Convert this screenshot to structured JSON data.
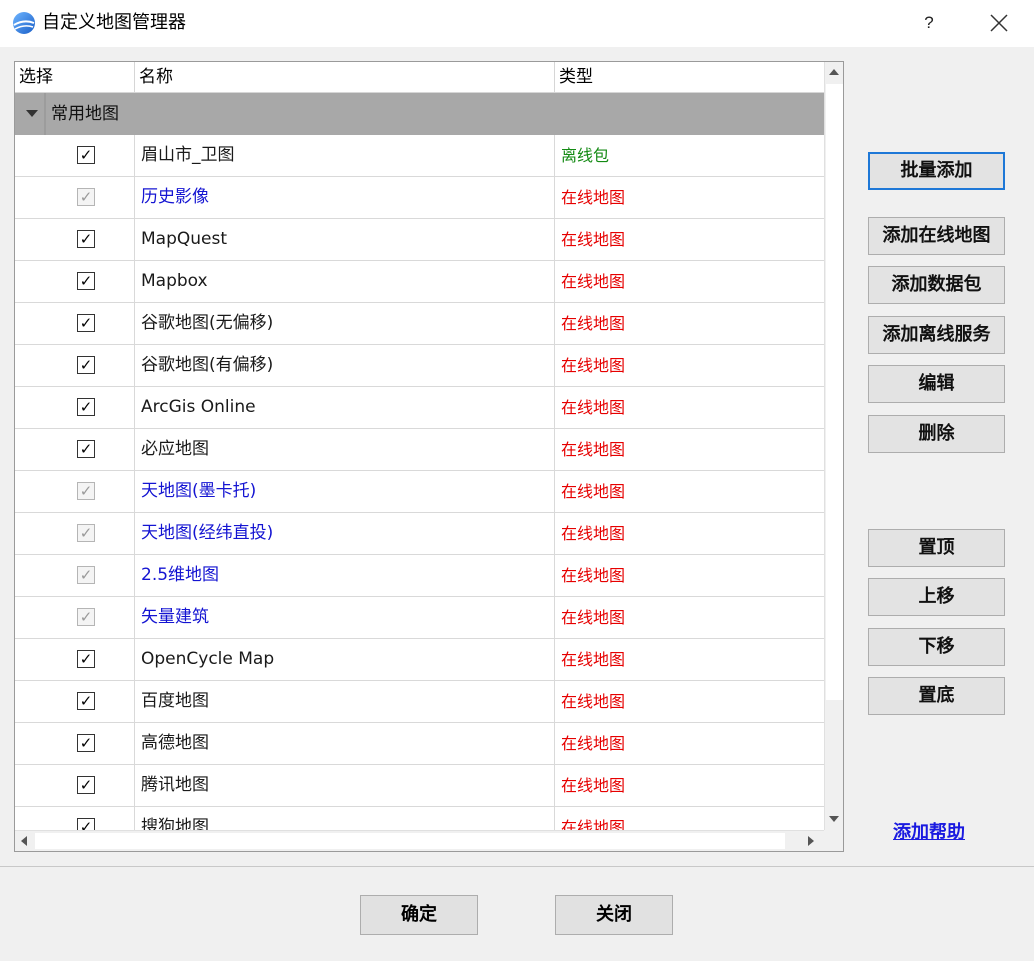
{
  "window": {
    "title": "自定义地图管理器",
    "help_label": "?"
  },
  "table": {
    "columns": [
      "选择",
      "名称",
      "类型"
    ],
    "group": {
      "label": "常用地图"
    },
    "rows": [
      {
        "name": "眉山市_卫图",
        "type": "离线包",
        "checked": true,
        "enabled": true,
        "name_color": "black",
        "type_color": "green"
      },
      {
        "name": "历史影像",
        "type": "在线地图",
        "checked": true,
        "enabled": false,
        "name_color": "blue",
        "type_color": "red"
      },
      {
        "name": "MapQuest",
        "type": "在线地图",
        "checked": true,
        "enabled": true,
        "name_color": "black",
        "type_color": "red"
      },
      {
        "name": "Mapbox",
        "type": "在线地图",
        "checked": true,
        "enabled": true,
        "name_color": "black",
        "type_color": "red"
      },
      {
        "name": "谷歌地图(无偏移)",
        "type": "在线地图",
        "checked": true,
        "enabled": true,
        "name_color": "black",
        "type_color": "red"
      },
      {
        "name": "谷歌地图(有偏移)",
        "type": "在线地图",
        "checked": true,
        "enabled": true,
        "name_color": "black",
        "type_color": "red"
      },
      {
        "name": "ArcGis Online",
        "type": "在线地图",
        "checked": true,
        "enabled": true,
        "name_color": "black",
        "type_color": "red"
      },
      {
        "name": "必应地图",
        "type": "在线地图",
        "checked": true,
        "enabled": true,
        "name_color": "black",
        "type_color": "red"
      },
      {
        "name": "天地图(墨卡托)",
        "type": "在线地图",
        "checked": true,
        "enabled": false,
        "name_color": "blue",
        "type_color": "red"
      },
      {
        "name": "天地图(经纬直投)",
        "type": "在线地图",
        "checked": true,
        "enabled": false,
        "name_color": "blue",
        "type_color": "red"
      },
      {
        "name": "2.5维地图",
        "type": "在线地图",
        "checked": true,
        "enabled": false,
        "name_color": "blue",
        "type_color": "red"
      },
      {
        "name": "矢量建筑",
        "type": "在线地图",
        "checked": true,
        "enabled": false,
        "name_color": "blue",
        "type_color": "red"
      },
      {
        "name": "OpenCycle Map",
        "type": "在线地图",
        "checked": true,
        "enabled": true,
        "name_color": "black",
        "type_color": "red"
      },
      {
        "name": "百度地图",
        "type": "在线地图",
        "checked": true,
        "enabled": true,
        "name_color": "black",
        "type_color": "red"
      },
      {
        "name": "高德地图",
        "type": "在线地图",
        "checked": true,
        "enabled": true,
        "name_color": "black",
        "type_color": "red"
      },
      {
        "name": "腾讯地图",
        "type": "在线地图",
        "checked": true,
        "enabled": true,
        "name_color": "black",
        "type_color": "red"
      },
      {
        "name": "搜狗地图",
        "type": "在线地图",
        "checked": true,
        "enabled": true,
        "name_color": "black",
        "type_color": "red"
      }
    ]
  },
  "side_buttons": {
    "batch_add": "批量添加",
    "add_online": "添加在线地图",
    "add_package": "添加数据包",
    "add_offline_service": "添加离线服务",
    "edit": "编辑",
    "delete": "删除",
    "top": "置顶",
    "up": "上移",
    "down": "下移",
    "bottom": "置底"
  },
  "help_link": "添加帮助",
  "footer": {
    "ok": "确定",
    "close": "关闭"
  },
  "check_mark": "✓",
  "colors": {
    "blue_text": "#1414d2",
    "red_text": "#e60000",
    "green_text": "#138a13",
    "default_button_border": "#1e78d7",
    "group_bg": "#a8a8a8"
  }
}
